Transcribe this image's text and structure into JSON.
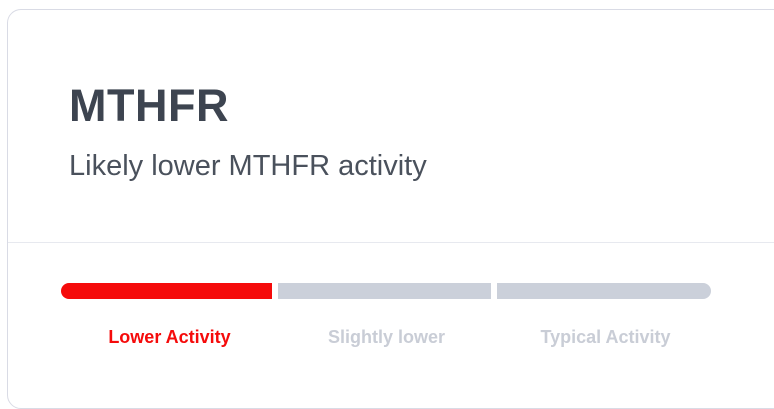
{
  "card": {
    "title": "MTHFR",
    "subtitle": "Likely lower MTHFR activity"
  },
  "activity_scale": {
    "selected": "Lower Activity",
    "active_color": "#f50b0b",
    "inactive_color": "#cbd0da",
    "levels": [
      {
        "label": "Lower Activity",
        "active": true
      },
      {
        "label": "Slightly lower",
        "active": false
      },
      {
        "label": "Typical Activity",
        "active": false
      }
    ]
  }
}
